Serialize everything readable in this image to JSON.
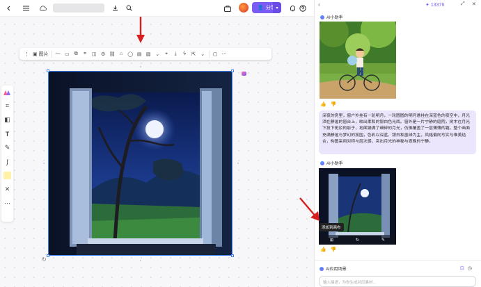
{
  "topbar": {
    "back_icon": "chevron-left-icon",
    "menu_icon": "hamburger-icon",
    "cloud_icon": "cloud-icon",
    "share_label": "分享",
    "share_icon": "user-plus-icon"
  },
  "toolbar": {
    "image_label": "图片",
    "items": [
      "dash-icon",
      "crop-icon",
      "frame-icon",
      "adjust-icon",
      "settings-icon",
      "link-icon",
      "tag-icon",
      "comment-icon",
      "note-icon",
      "image-swap-icon",
      "chevron-down-icon",
      "scan-icon",
      "download-icon",
      "magic-icon",
      "share-icon",
      "chevron-down-icon",
      "code-icon",
      "more-icon"
    ]
  },
  "tools": [
    "palette-icon",
    "frame-icon",
    "shape-icon",
    "text-icon",
    "pen-icon",
    "connector-icon",
    "sticky-note-icon",
    "cross-icon",
    "more-icon"
  ],
  "panel": {
    "credits": "13376",
    "bot_name": "AI小助手",
    "prompt_text": "深夜的房里，窗户外挂有一轮明月，一轮圆圆的明月悬挂在深蓝色的夜空中，月光洒在静谧的窗台上，映出柔和的银白色光辉。窗外是一片宁静的庭院，树木在月光下投下斑驳的影子，地面铺满了细碎的月光，仿佛覆盖了一层薄薄的霜。整个画面充满静谧与梦幻的氛围，色彩以深蓝、银白和墨绿为主，风格偏向写实与唯美结合，构图采用对称与层次感，突出月光的神秘与夜晚的宁静。",
    "tooltip": "添加到画布",
    "scene_label": "AI应用场景",
    "input_placeholder": "输入描述，为你生成对应素材..."
  },
  "colors": {
    "accent": "#7a5cf5",
    "selection": "#3b82f6",
    "arrow": "#d81f1f"
  }
}
